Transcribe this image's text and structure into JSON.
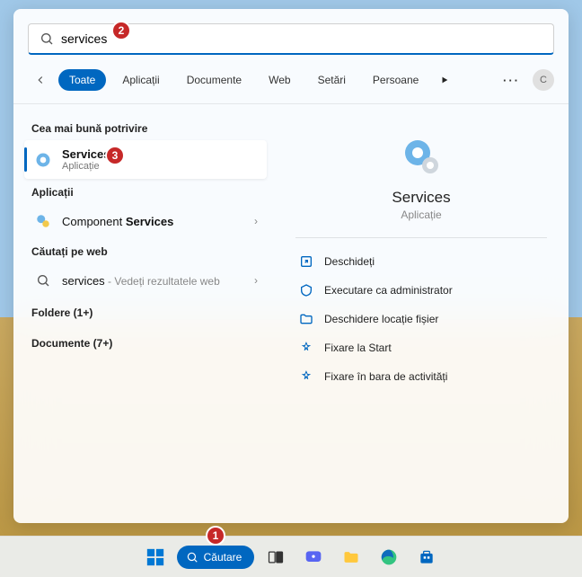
{
  "search": {
    "value": "services"
  },
  "tabs": [
    "Toate",
    "Aplicații",
    "Documente",
    "Web",
    "Setări",
    "Persoane"
  ],
  "avatar_initial": "C",
  "left": {
    "best_match_header": "Cea mai bună potrivire",
    "best_match": {
      "title": "Services",
      "sub": "Aplicație"
    },
    "apps_header": "Aplicații",
    "apps_item_prefix": "Component ",
    "apps_item_bold": "Services",
    "web_header": "Căutați pe web",
    "web_item": "services",
    "web_item_suffix": " - Vedeți rezultatele web",
    "folders": "Foldere (1+)",
    "documents": "Documente (7+)"
  },
  "preview": {
    "title": "Services",
    "sub": "Aplicație",
    "actions": [
      "Deschideți",
      "Executare ca administrator",
      "Deschidere locație fișier",
      "Fixare la Start",
      "Fixare în bara de activități"
    ]
  },
  "taskbar": {
    "search_label": "Căutare"
  },
  "badges": {
    "b1": "1",
    "b2": "2",
    "b3": "3"
  }
}
